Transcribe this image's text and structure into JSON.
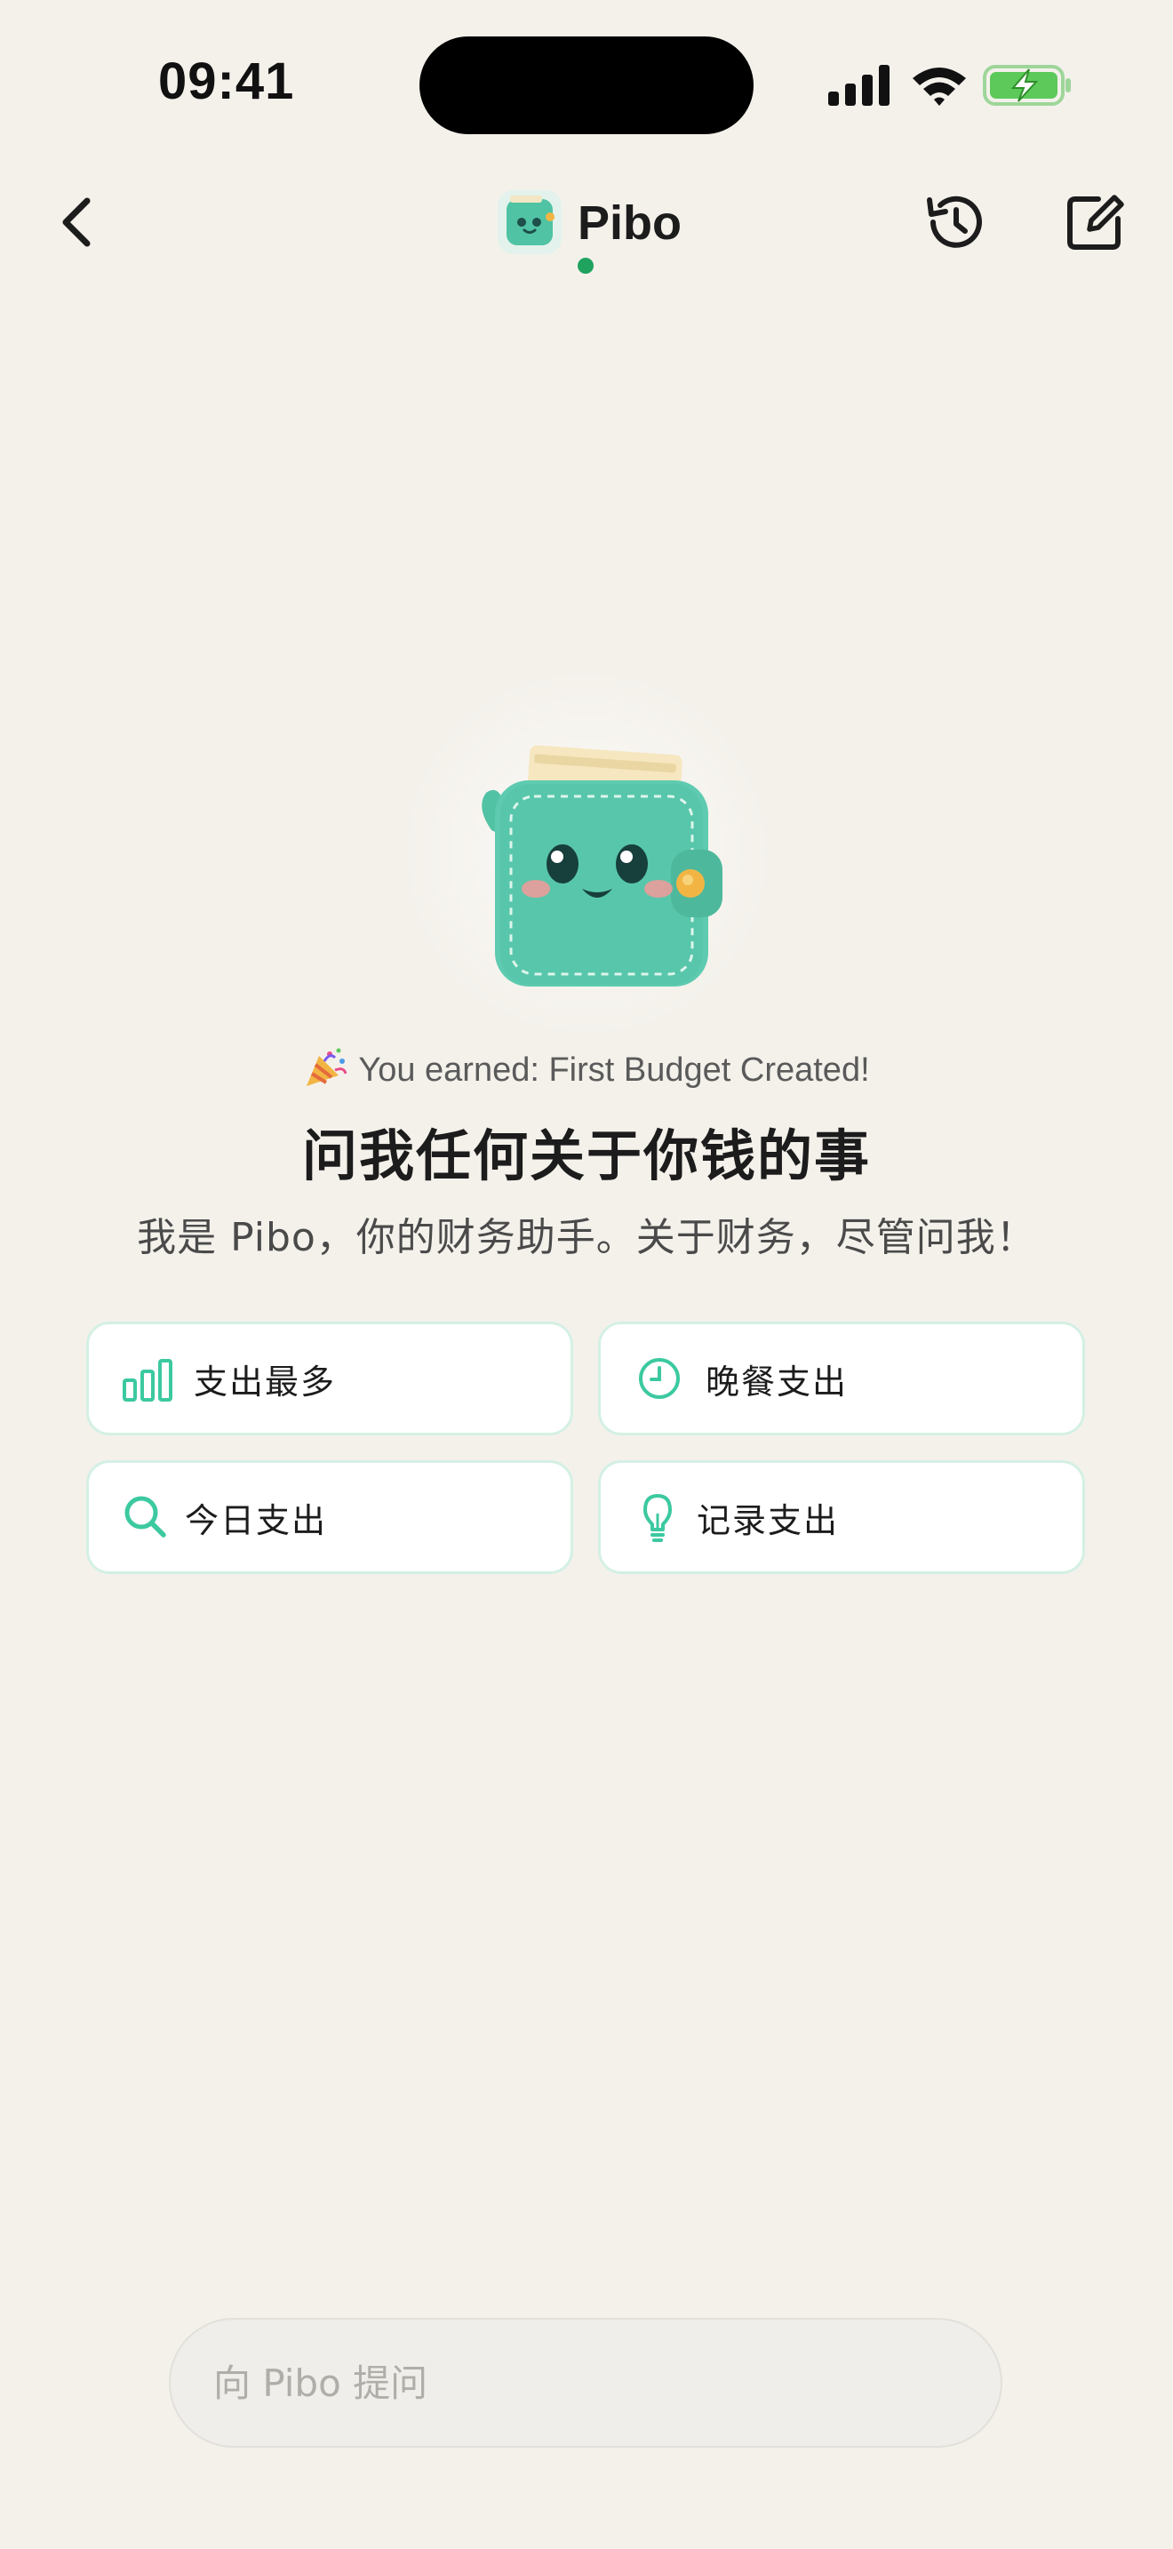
{
  "status_bar": {
    "time": "09:41",
    "icons": [
      "signal-icon",
      "wifi-icon",
      "battery-charging-icon"
    ]
  },
  "nav": {
    "title": "Pibo",
    "back_icon": "chevron-left-icon",
    "history_icon": "history-icon",
    "compose_icon": "compose-icon",
    "online_status_color": "#1FA35E"
  },
  "hero": {
    "achievement_text": "You earned: First Budget Created!",
    "achievement_icon": "party-popper-icon",
    "headline": "问我任何关于你钱的事",
    "subtitle": "我是 Pibo，你的财务助手。关于财务，尽管问我！"
  },
  "suggestions": [
    {
      "label": "支出最多",
      "icon": "bar-chart-icon"
    },
    {
      "label": "晚餐支出",
      "icon": "clock-icon"
    },
    {
      "label": "今日支出",
      "icon": "search-icon"
    },
    {
      "label": "记录支出",
      "icon": "lightbulb-icon"
    }
  ],
  "input": {
    "placeholder": "向 Pibo 提问",
    "value": ""
  },
  "colors": {
    "background": "#F4F1EB",
    "accent": "#3CC9A0",
    "mascot": "#5ECBB0",
    "card_border": "#D4F0E4"
  }
}
